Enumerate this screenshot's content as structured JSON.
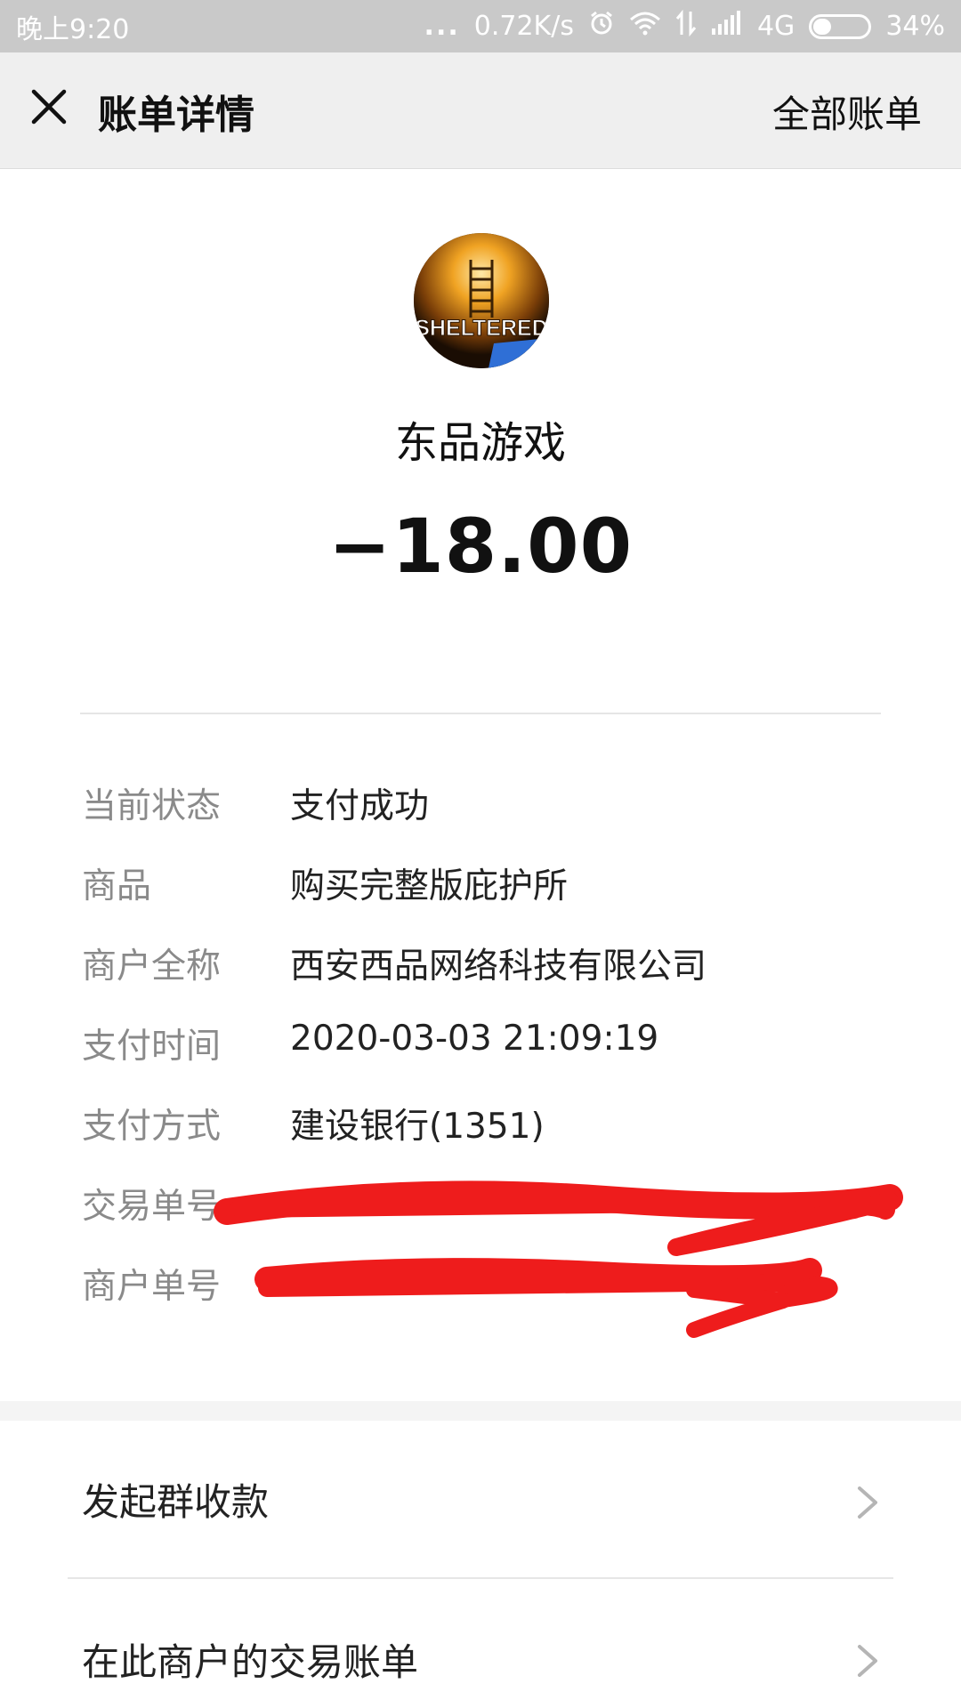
{
  "status_bar": {
    "time": "晚上9:20",
    "dots": "...",
    "speed": "0.72K/s",
    "network": "4G",
    "battery": "34%",
    "battery_level": 0.34,
    "icons": [
      "alarm-icon",
      "wifi-icon",
      "data-transfer-icon",
      "signal-icon",
      "battery-icon"
    ]
  },
  "header": {
    "title": "账单详情",
    "close_icon": "close-icon",
    "right_link": "全部账单"
  },
  "merchant": {
    "avatar_text": "SHELTERED",
    "name": "东品游戏",
    "amount": "−18.00"
  },
  "details": [
    {
      "label": "当前状态",
      "value": "支付成功"
    },
    {
      "label": "商品",
      "value": "购买完整版庇护所"
    },
    {
      "label": "商户全称",
      "value": "西安西品网络科技有限公司"
    },
    {
      "label": "支付时间",
      "value": "2020-03-03 21:09:19"
    },
    {
      "label": "支付方式",
      "value": "建设银行(1351)"
    },
    {
      "label": "交易单号",
      "value": ""
    },
    {
      "label": "商户单号",
      "value": ""
    }
  ],
  "actions": [
    {
      "label": "发起群收款",
      "icon": "chevron-right-icon"
    },
    {
      "label": "在此商户的交易账单",
      "icon": "chevron-right-icon"
    }
  ],
  "colors": {
    "status_bar_bg": "#c9c9c9",
    "header_bg": "#efefef",
    "label_gray": "#8a8a8a",
    "redaction_red": "#ee1c1c"
  }
}
